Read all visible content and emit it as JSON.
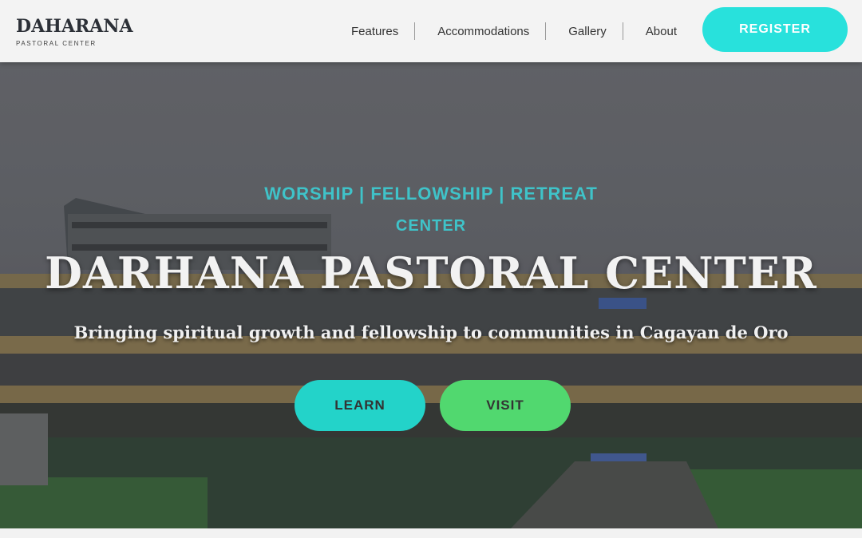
{
  "brand": {
    "logo_main": "HARANA",
    "logo_prefix": "DA",
    "logo_tagline": "PASTORAL CENTER"
  },
  "nav": {
    "items": [
      {
        "label": "Features"
      },
      {
        "label": "Accommodations"
      },
      {
        "label": "Gallery"
      },
      {
        "label": "About"
      }
    ],
    "register_label": "REGISTER"
  },
  "hero": {
    "eyebrow": "WORSHIP | FELLOWSHIP | RETREAT",
    "eyebrow_line2": "CENTER",
    "title": "DARHANA PASTORAL CENTER",
    "subtitle": "Bringing spiritual growth and fellowship to communities in Cagayan de Oro",
    "buttons": [
      {
        "label": "LEARN"
      },
      {
        "label": "VISIT"
      }
    ]
  },
  "colors": {
    "accent": "#28e1dc",
    "button_primary": "#23d3c9",
    "button_secondary": "#51d86f",
    "eyebrow": "#3fc3c9"
  }
}
